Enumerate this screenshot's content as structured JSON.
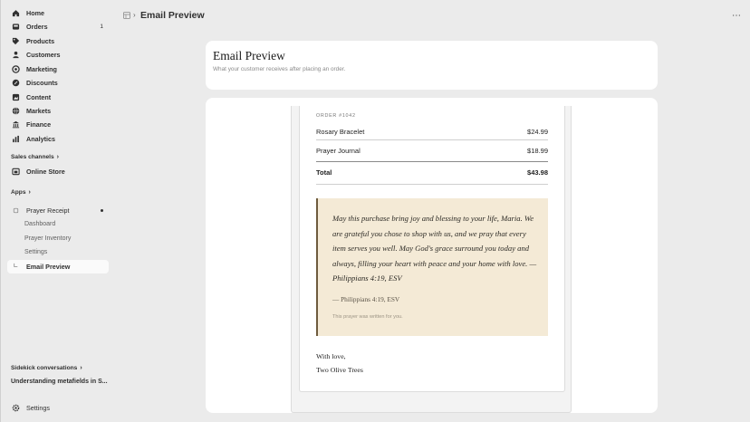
{
  "sidebar": {
    "nav": [
      {
        "label": "Home",
        "icon": "home-icon"
      },
      {
        "label": "Orders",
        "icon": "orders-icon",
        "count": "1"
      },
      {
        "label": "Products",
        "icon": "tag-icon"
      },
      {
        "label": "Customers",
        "icon": "person-icon"
      },
      {
        "label": "Marketing",
        "icon": "target-icon"
      },
      {
        "label": "Discounts",
        "icon": "discount-icon"
      },
      {
        "label": "Content",
        "icon": "content-icon"
      },
      {
        "label": "Markets",
        "icon": "globe-icon"
      },
      {
        "label": "Finance",
        "icon": "bank-icon"
      },
      {
        "label": "Analytics",
        "icon": "chart-icon"
      }
    ],
    "sales_channels": {
      "heading": "Sales channels",
      "online_store": "Online Store"
    },
    "apps": {
      "heading": "Apps",
      "app_name": "Prayer Receipt",
      "sub_items": [
        "Dashboard",
        "Prayer Inventory",
        "Settings",
        "Email Preview"
      ]
    },
    "sidekick": {
      "heading": "Sidekick conversations",
      "item": "Understanding metafields in S..."
    },
    "settings_label": "Settings"
  },
  "topbar": {
    "title": "Email Preview"
  },
  "header_card": {
    "title": "Email Preview",
    "subtitle": "What your customer receives after placing an order."
  },
  "email": {
    "order_number": "ORDER #1042",
    "items": [
      {
        "name": "Rosary Bracelet",
        "price": "$24.99"
      },
      {
        "name": "Prayer Journal",
        "price": "$18.99"
      }
    ],
    "total_label": "Total",
    "total_value": "$43.98",
    "prayer_text": "May this purchase bring joy and blessing to your life, Maria. We are grateful you chose to shop with us, and we pray that every item serves you well. May God's grace surround you today and always, filling your heart with peace and your home with love. — Philippians 4:19, ESV",
    "prayer_reference": "— Philippians 4:19, ESV",
    "prayer_note": "This prayer was written for you.",
    "closing": "With love,",
    "signature": "Two Olive Trees"
  },
  "colors": {
    "accent_box": "#f4ead6",
    "box_border": "#6e5b3d"
  }
}
